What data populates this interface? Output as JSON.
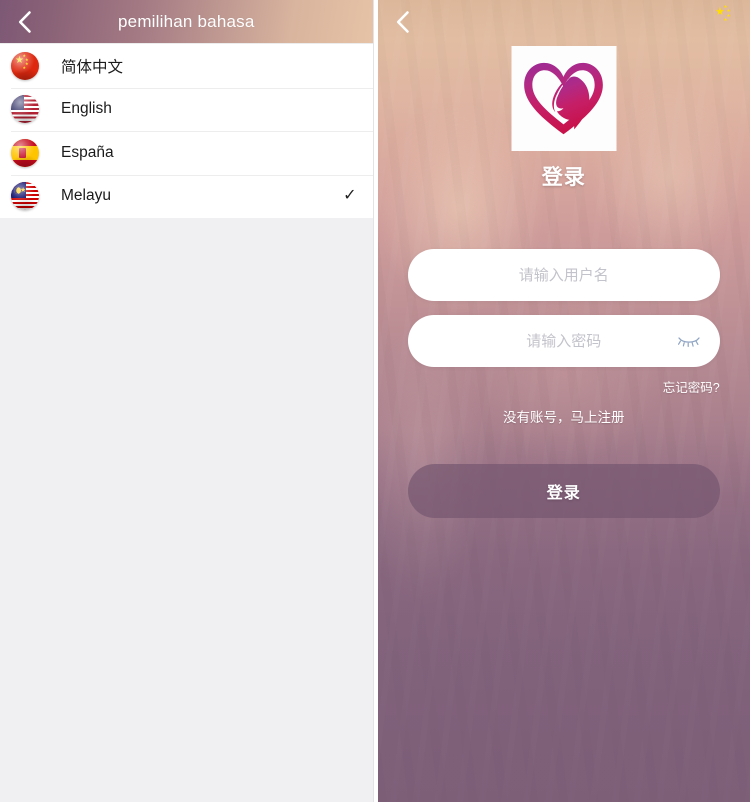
{
  "language_panel": {
    "header": {
      "back_icon": "chevron-left-icon",
      "title": "pemilihan bahasa"
    },
    "items": [
      {
        "label": "简体中文",
        "flag": "flag-china-icon",
        "selected": false,
        "check": ""
      },
      {
        "label": "English",
        "flag": "flag-usa-icon",
        "selected": false,
        "check": ""
      },
      {
        "label": "España",
        "flag": "flag-spain-icon",
        "selected": false,
        "check": ""
      },
      {
        "label": "Melayu",
        "flag": "flag-malaysia-icon",
        "selected": true,
        "check": "✓"
      }
    ]
  },
  "login_panel": {
    "back_icon": "chevron-left-icon",
    "language_badge_icon": "flag-china-icon",
    "logo_icon": "heart-woman-logo-icon",
    "title": "登录",
    "username_field": {
      "value": "",
      "placeholder": "请输入用户名"
    },
    "password_field": {
      "value": "",
      "placeholder": "请输入密码",
      "toggle_icon": "eye-closed-icon"
    },
    "forgot_password_label": "忘记密码?",
    "register_label": "没有账号，马上注册",
    "login_button_label": "登录"
  },
  "colors": {
    "header_gradient_start": "#7d5875",
    "header_gradient_end": "#e6c3a6",
    "panel_background_bottom": "#7c5f78",
    "list_background": "#ffffff",
    "page_background": "#f0f0f2",
    "logo_magenta": "#b12a7c",
    "logo_crimson": "#c8175a",
    "button_fill": "#765770",
    "placeholder_text": "#c3c3cb"
  }
}
